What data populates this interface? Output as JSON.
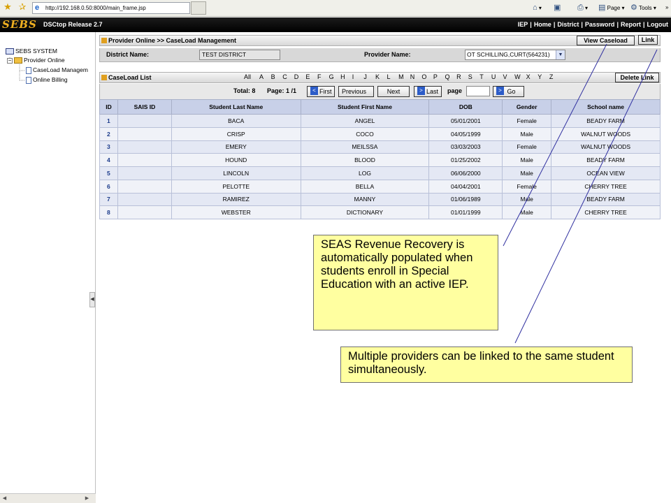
{
  "browser": {
    "url": "http://192.168.0.50:8000/main_frame.jsp",
    "tools": {
      "page": "Page",
      "tools": "Tools"
    }
  },
  "header": {
    "logo": "SEBS",
    "release": "DSCtop Release 2.7",
    "nav": [
      "IEP",
      "Home",
      "District",
      "Password",
      "Report",
      "Logout"
    ]
  },
  "sidebar": {
    "root": "SEBS SYSTEM",
    "folder": "Provider Online",
    "items": [
      "CaseLoad Managem",
      "Online Billing"
    ]
  },
  "provider_section": {
    "title": "Provider Online >> CaseLoad Management",
    "view_caseload": "View Caseload",
    "link": "Link",
    "district_label": "District Name:",
    "district_value": "TEST DISTRICT",
    "provider_label": "Provider Name:",
    "provider_value": "OT SCHILLING,CURT(564231)"
  },
  "caseload": {
    "title": "CaseLoad List",
    "delete_link": "Delete Link",
    "alphabet": [
      "All",
      "A",
      "B",
      "C",
      "D",
      "E",
      "F",
      "G",
      "H",
      "I",
      "J",
      "K",
      "L",
      "M",
      "N",
      "O",
      "P",
      "Q",
      "R",
      "S",
      "T",
      "U",
      "V",
      "W",
      "X",
      "Y",
      "Z"
    ],
    "pager": {
      "total": "Total: 8",
      "page": "Page: 1 /1",
      "first": "First",
      "previous": "Previous",
      "next": "Next",
      "last": "Last",
      "page_label": "page",
      "go": "Go"
    },
    "columns": [
      "ID",
      "SAIS ID",
      "Student Last Name",
      "Student First Name",
      "DOB",
      "Gender",
      "School name"
    ],
    "rows": [
      [
        "1",
        "",
        "BACA",
        "ANGEL",
        "05/01/2001",
        "Female",
        "BEADY FARM"
      ],
      [
        "2",
        "",
        "CRISP",
        "COCO",
        "04/05/1999",
        "Male",
        "WALNUT WOODS"
      ],
      [
        "3",
        "",
        "EMERY",
        "MEILSSA",
        "03/03/2003",
        "Female",
        "WALNUT WOODS"
      ],
      [
        "4",
        "",
        "HOUND",
        "BLOOD",
        "01/25/2002",
        "Male",
        "BEADY FARM"
      ],
      [
        "5",
        "",
        "LINCOLN",
        "LOG",
        "06/06/2000",
        "Male",
        "OCEAN VIEW"
      ],
      [
        "6",
        "",
        "PELOTTE",
        "BELLA",
        "04/04/2001",
        "Female",
        "CHERRY TREE"
      ],
      [
        "7",
        "",
        "RAMIREZ",
        "MANNY",
        "01/06/1989",
        "Male",
        "BEADY FARM"
      ],
      [
        "8",
        "",
        "WEBSTER",
        "DICTIONARY",
        "01/01/1999",
        "Male",
        "CHERRY TREE"
      ]
    ]
  },
  "callouts": {
    "revenue": "SEAS Revenue Recovery is automatically populated when students enroll in Special Education with an active IEP.",
    "providers": "Multiple providers can be linked to the same student simultaneously."
  },
  "colors": {
    "header_bg": "#000000",
    "logo": "#f0b020",
    "table_header": "#c8d0e8",
    "callout_bg": "#ffffa0"
  }
}
